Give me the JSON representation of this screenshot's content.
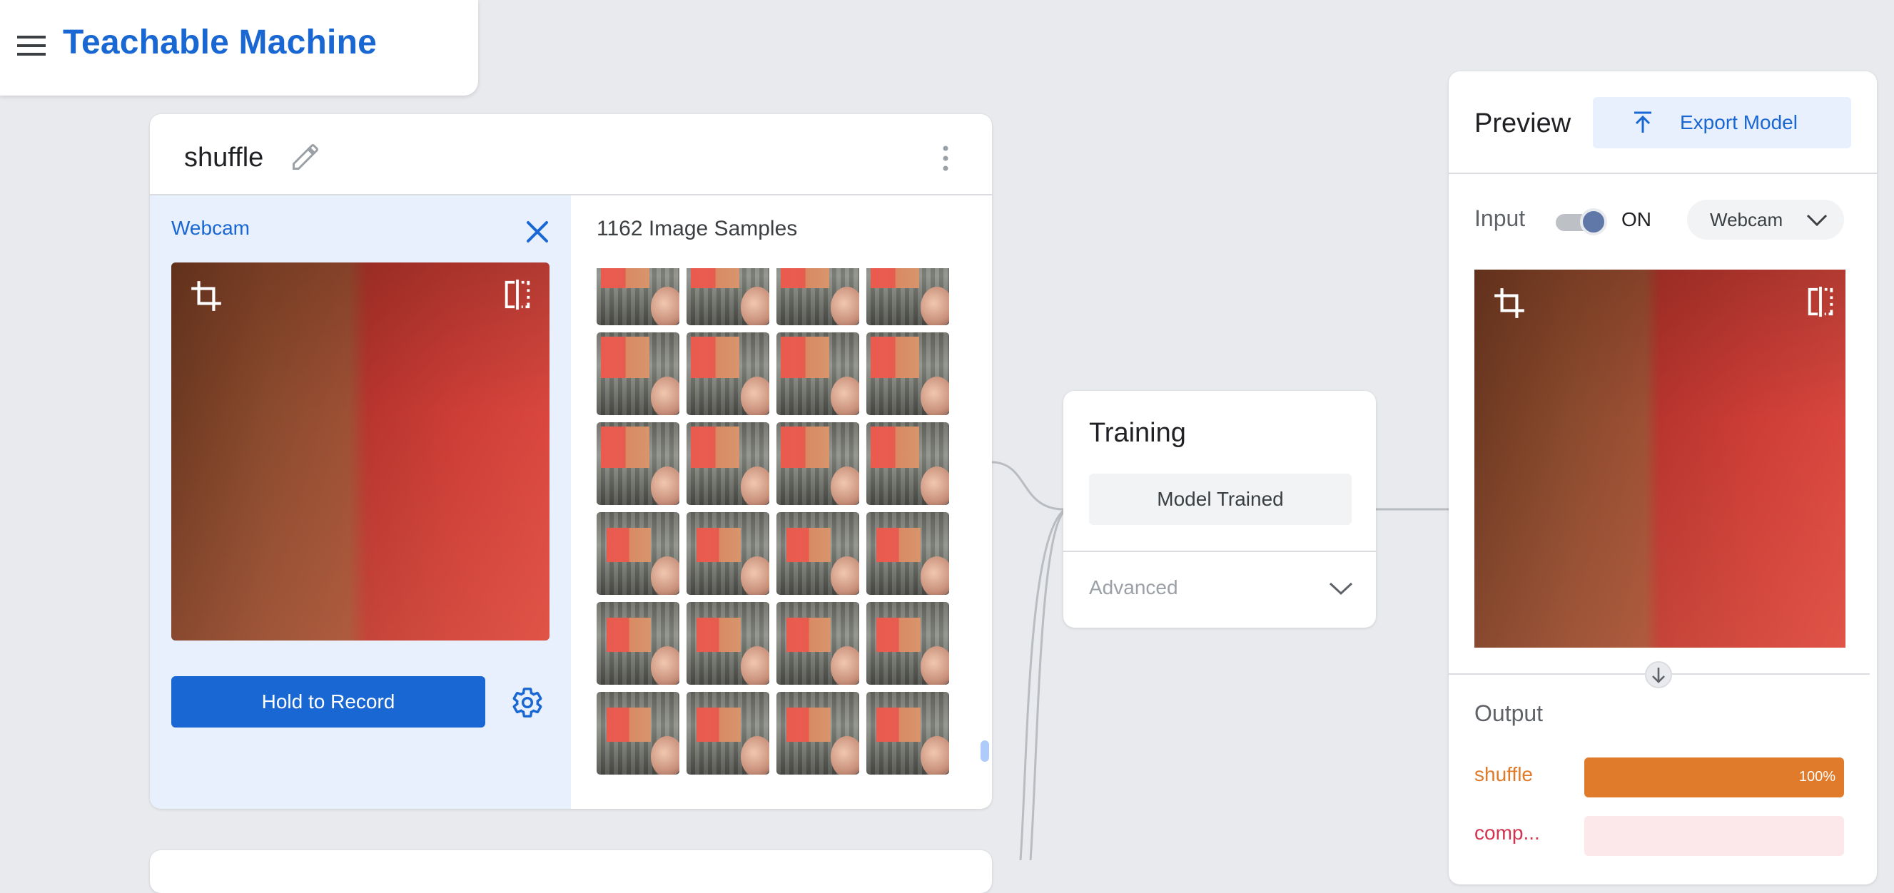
{
  "app": {
    "title": "Teachable Machine"
  },
  "class_card": {
    "name": "shuffle",
    "webcam_label": "Webcam",
    "record_button": "Hold to Record",
    "samples_title": "1162 Image Samples",
    "thumbnail_count": 24
  },
  "training": {
    "title": "Training",
    "status_button": "Model Trained",
    "advanced_label": "Advanced"
  },
  "preview": {
    "title": "Preview",
    "export_button": "Export Model",
    "input_label": "Input",
    "toggle_state": "ON",
    "source_select": "Webcam",
    "output_label": "Output",
    "outputs": [
      {
        "label": "shuffle",
        "percent": 100,
        "percent_text": "100%",
        "color": "#e07b2b",
        "track_color": "#fce9d8"
      },
      {
        "label": "comp...",
        "percent": 0,
        "percent_text": "",
        "color": "#d3334f",
        "track_color": "#fce8ea"
      }
    ]
  },
  "icons": [
    "menu-icon",
    "edit-icon",
    "more-vert-icon",
    "close-icon",
    "crop-icon",
    "flip-icon",
    "settings-icon",
    "chevron-down-icon",
    "upload-icon",
    "arrow-down-icon"
  ],
  "colors": {
    "accent": "#1967d2",
    "background": "#e8eaed"
  }
}
